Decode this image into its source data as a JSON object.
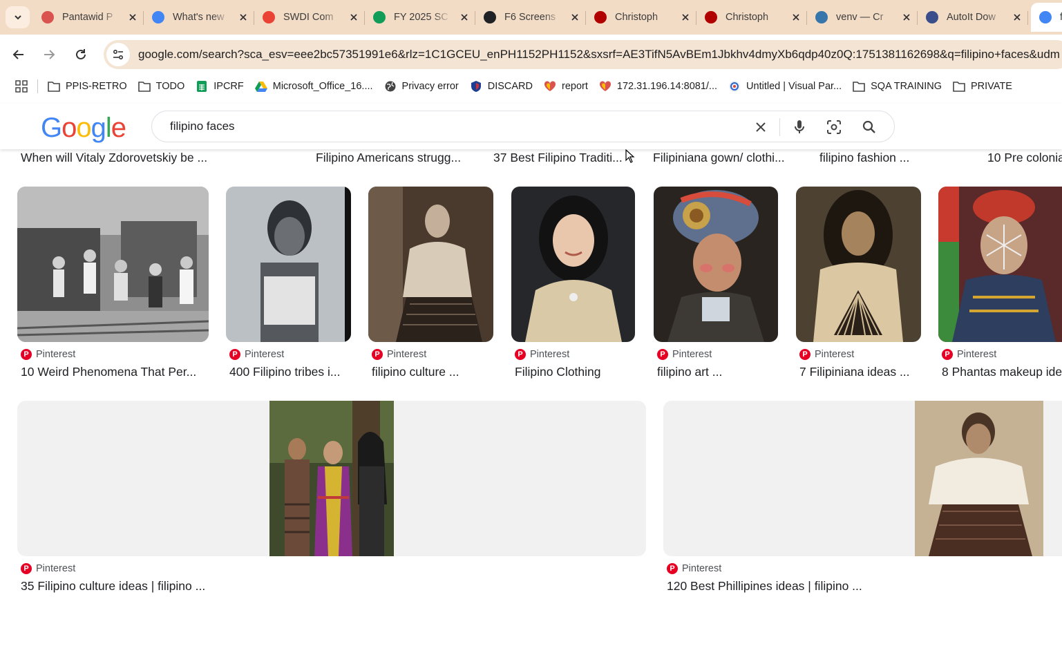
{
  "browser": {
    "tabs": [
      {
        "title": "Pantawid P",
        "favicon": "heart-favicon",
        "color": "#d9534f"
      },
      {
        "title": "What's new",
        "favicon": "chrome-favicon",
        "color": "#4285f4"
      },
      {
        "title": "SWDI Com",
        "favicon": "gmail-favicon",
        "color": "#ea4335"
      },
      {
        "title": "FY 2025 SC",
        "favicon": "drive-favicon",
        "color": "#0f9d58"
      },
      {
        "title": "F6 Screens",
        "favicon": "openai-favicon",
        "color": "#202124"
      },
      {
        "title": "Christoph",
        "favicon": "red-circle-favicon",
        "color": "#b00000"
      },
      {
        "title": "Christoph",
        "favicon": "red-circle-favicon",
        "color": "#b00000"
      },
      {
        "title": "venv — Cr",
        "favicon": "python-favicon",
        "color": "#3776ab"
      },
      {
        "title": "AutoIt Dow",
        "favicon": "autoit-favicon",
        "color": "#3b4e8c"
      },
      {
        "title": "fi",
        "favicon": "google-favicon",
        "color": "#4285f4"
      }
    ],
    "url": "google.com/search?sca_esv=eee2bc57351991e6&rlz=1C1GCEU_enPH1152PH1152&sxsrf=AE3TifN5AvBEm1Jbkhv4dmyXb6qdp40z0Q:1751381162698&q=filipino+faces&udm"
  },
  "bookmarks": [
    {
      "label": "PPIS-RETRO",
      "icon": "folder-icon"
    },
    {
      "label": "TODO",
      "icon": "folder-icon"
    },
    {
      "label": "IPCRF",
      "icon": "sheets-icon"
    },
    {
      "label": "Microsoft_Office_16....",
      "icon": "drive-icon"
    },
    {
      "label": "Privacy error",
      "icon": "globe-icon"
    },
    {
      "label": "DISCARD",
      "icon": "shield-icon"
    },
    {
      "label": "report",
      "icon": "heart-icon"
    },
    {
      "label": "172.31.196.14:8081/...",
      "icon": "heart-icon"
    },
    {
      "label": "Untitled | Visual Par...",
      "icon": "paradigm-icon"
    },
    {
      "label": "SQA TRAINING",
      "icon": "folder-icon"
    },
    {
      "label": "PRIVATE",
      "icon": "folder-icon"
    }
  ],
  "search": {
    "logo": "Google",
    "query": "filipino faces"
  },
  "previous_captions": [
    "When will Vitaly Zdorovetskiy be ...",
    "Filipino Americans strugg...",
    "37 Best Filipino Traditi...",
    "Filipiniana gown/ clothi...",
    "filipino fashion ...",
    "10 Pre colonia"
  ],
  "results_row1": [
    {
      "source": "Pinterest",
      "caption": "10 Weird Phenomena That Per..."
    },
    {
      "source": "Pinterest",
      "caption": "400 Filipino tribes i..."
    },
    {
      "source": "Pinterest",
      "caption": "filipino culture ..."
    },
    {
      "source": "Pinterest",
      "caption": "Filipino Clothing"
    },
    {
      "source": "Pinterest",
      "caption": "filipino art ..."
    },
    {
      "source": "Pinterest",
      "caption": "7 Filipiniana ideas ..."
    },
    {
      "source": "Pinterest",
      "caption": "8 Phantas makeup ide"
    }
  ],
  "results_row2": [
    {
      "source": "Pinterest",
      "caption": "35 Filipino culture ideas | filipino ..."
    },
    {
      "source": "Pinterest",
      "caption": "120 Best Phillipines ideas | filipino ..."
    }
  ],
  "colors": {
    "tabstrip": "#f3dcc6",
    "omnibox": "#f4e4d4",
    "pinterest": "#e60023"
  }
}
